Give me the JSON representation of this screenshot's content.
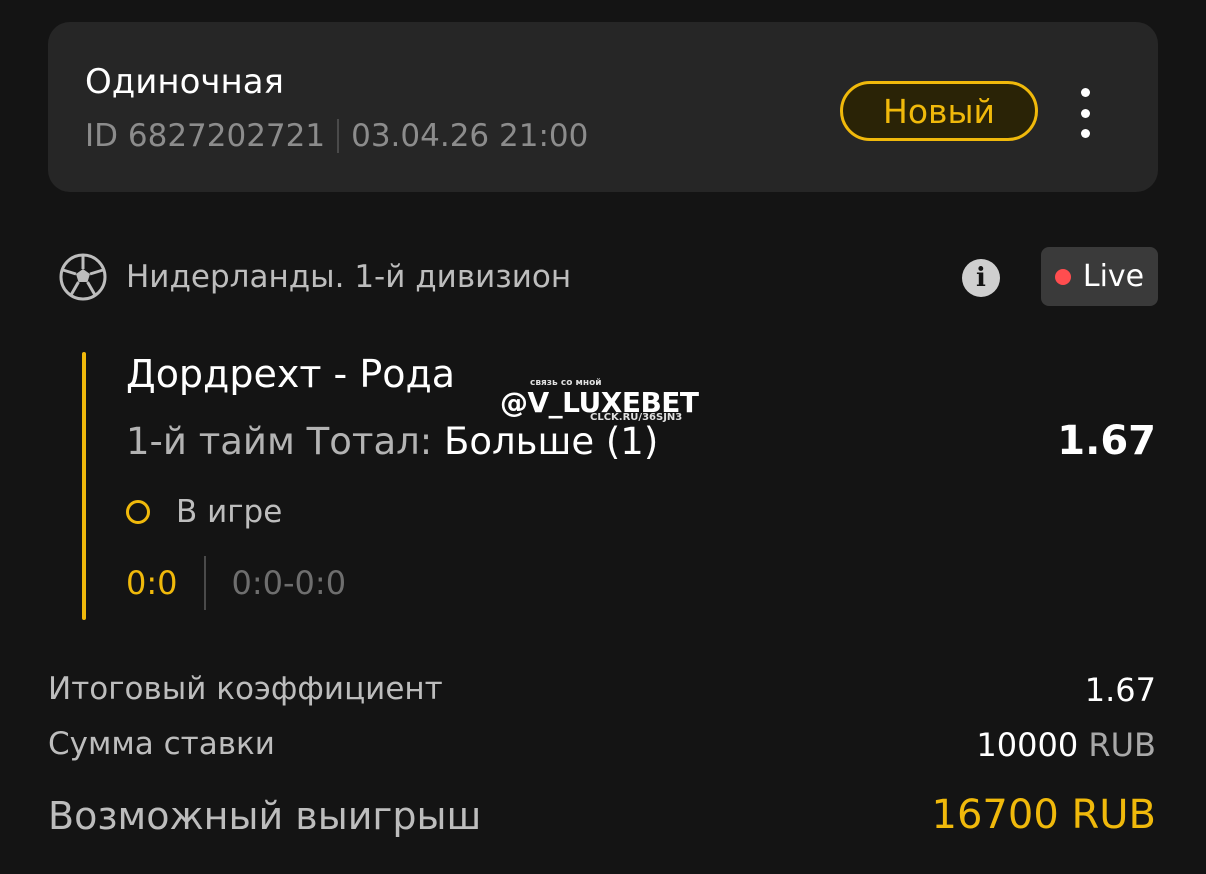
{
  "header": {
    "bet_type": "Одиночная",
    "bet_id": "ID 6827202721",
    "datetime": "03.04.26 21:00",
    "status_badge": "Новый"
  },
  "event": {
    "league": "Нидерланды. 1-й дивизион",
    "live_label": "Live",
    "teams": "Дордрехт - Рода",
    "market_label": "1-й тайм Тотал:",
    "pick": "Больше (1)",
    "odds": "1.67",
    "status": "В игре",
    "score": "0:0",
    "period_scores": "0:0-0:0"
  },
  "watermark": {
    "small": "связь со мной",
    "handle": "@V_LUXEBET",
    "link": "CLCK.RU/36SJN3"
  },
  "summary": {
    "total_odds_label": "Итоговый коэффициент",
    "total_odds_value": "1.67",
    "stake_label": "Сумма ставки",
    "stake_amount": "10000",
    "stake_currency": "RUB",
    "win_label": "Возможный выигрыш",
    "win_value": "16700 RUB"
  },
  "icons": {
    "sport": "soccer-ball-icon",
    "info": "info-icon",
    "menu": "more-vertical-icon"
  },
  "colors": {
    "accent": "#f0b90b",
    "live_dot": "#ff4d4f",
    "card_bg": "#262626",
    "page_bg": "#141414"
  }
}
